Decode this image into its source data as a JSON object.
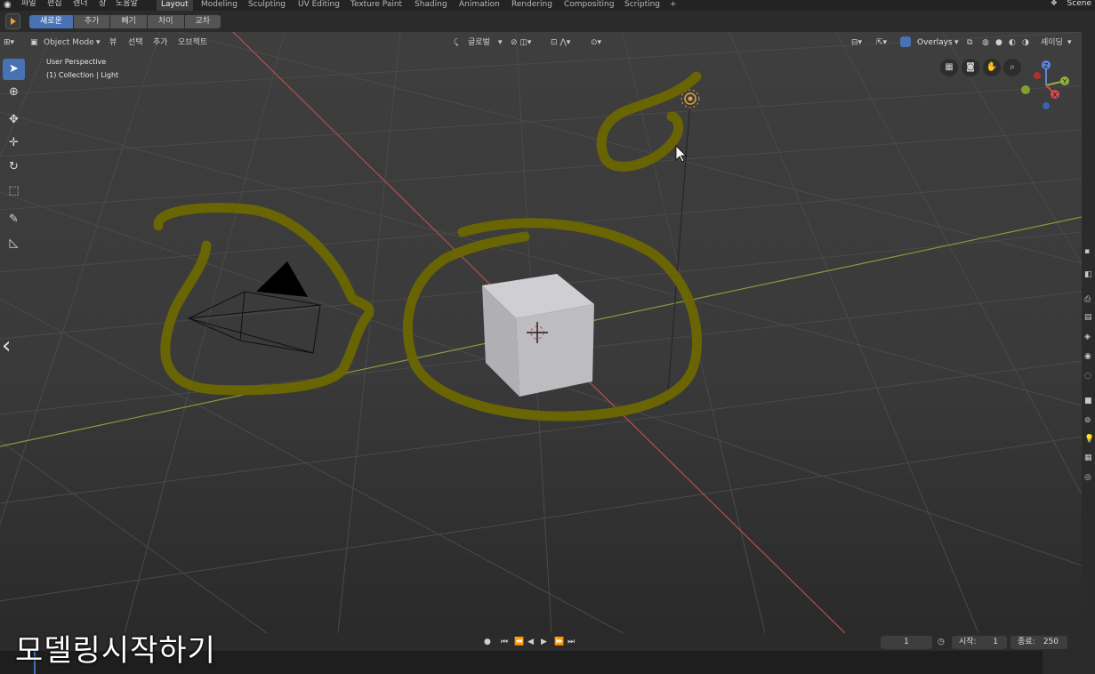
{
  "menu": {
    "items": [
      "파일",
      "편집",
      "렌더",
      "창",
      "도움말"
    ],
    "workspaces": [
      "Layout",
      "Modeling",
      "Sculpting",
      "UV Editing",
      "Texture Paint",
      "Shading",
      "Animation",
      "Rendering",
      "Compositing",
      "Scripting"
    ],
    "active_workspace": "Layout",
    "add_tab": "+",
    "scene": "Scene"
  },
  "toolbar": {
    "bool_modes": [
      "새로운",
      "추가",
      "빼기",
      "차이",
      "교차"
    ]
  },
  "viewport_header": {
    "mode": "Object Mode",
    "view": "뷰",
    "select": "선택",
    "add": "추가",
    "object": "오브젝트",
    "orientation": "글로벌",
    "overlays": "Overlays",
    "shading": "셰이딩"
  },
  "viewport": {
    "perspective": "User Perspective",
    "collection": "(1) Collection | Light",
    "gizmo": {
      "z": "Z",
      "x": "X",
      "y": "Y"
    }
  },
  "timeline": {
    "current_frame": "1",
    "start_label": "시작:",
    "start": "1",
    "end_label": "종료:",
    "end": "250"
  },
  "caption": "모델링시작하기",
  "colors": {
    "accent": "#4772b3",
    "highlight_stroke": "#6b6700",
    "x_axis": "#b8504a",
    "y_axis": "#8a9a3a",
    "cube": "#b9b9bd"
  }
}
